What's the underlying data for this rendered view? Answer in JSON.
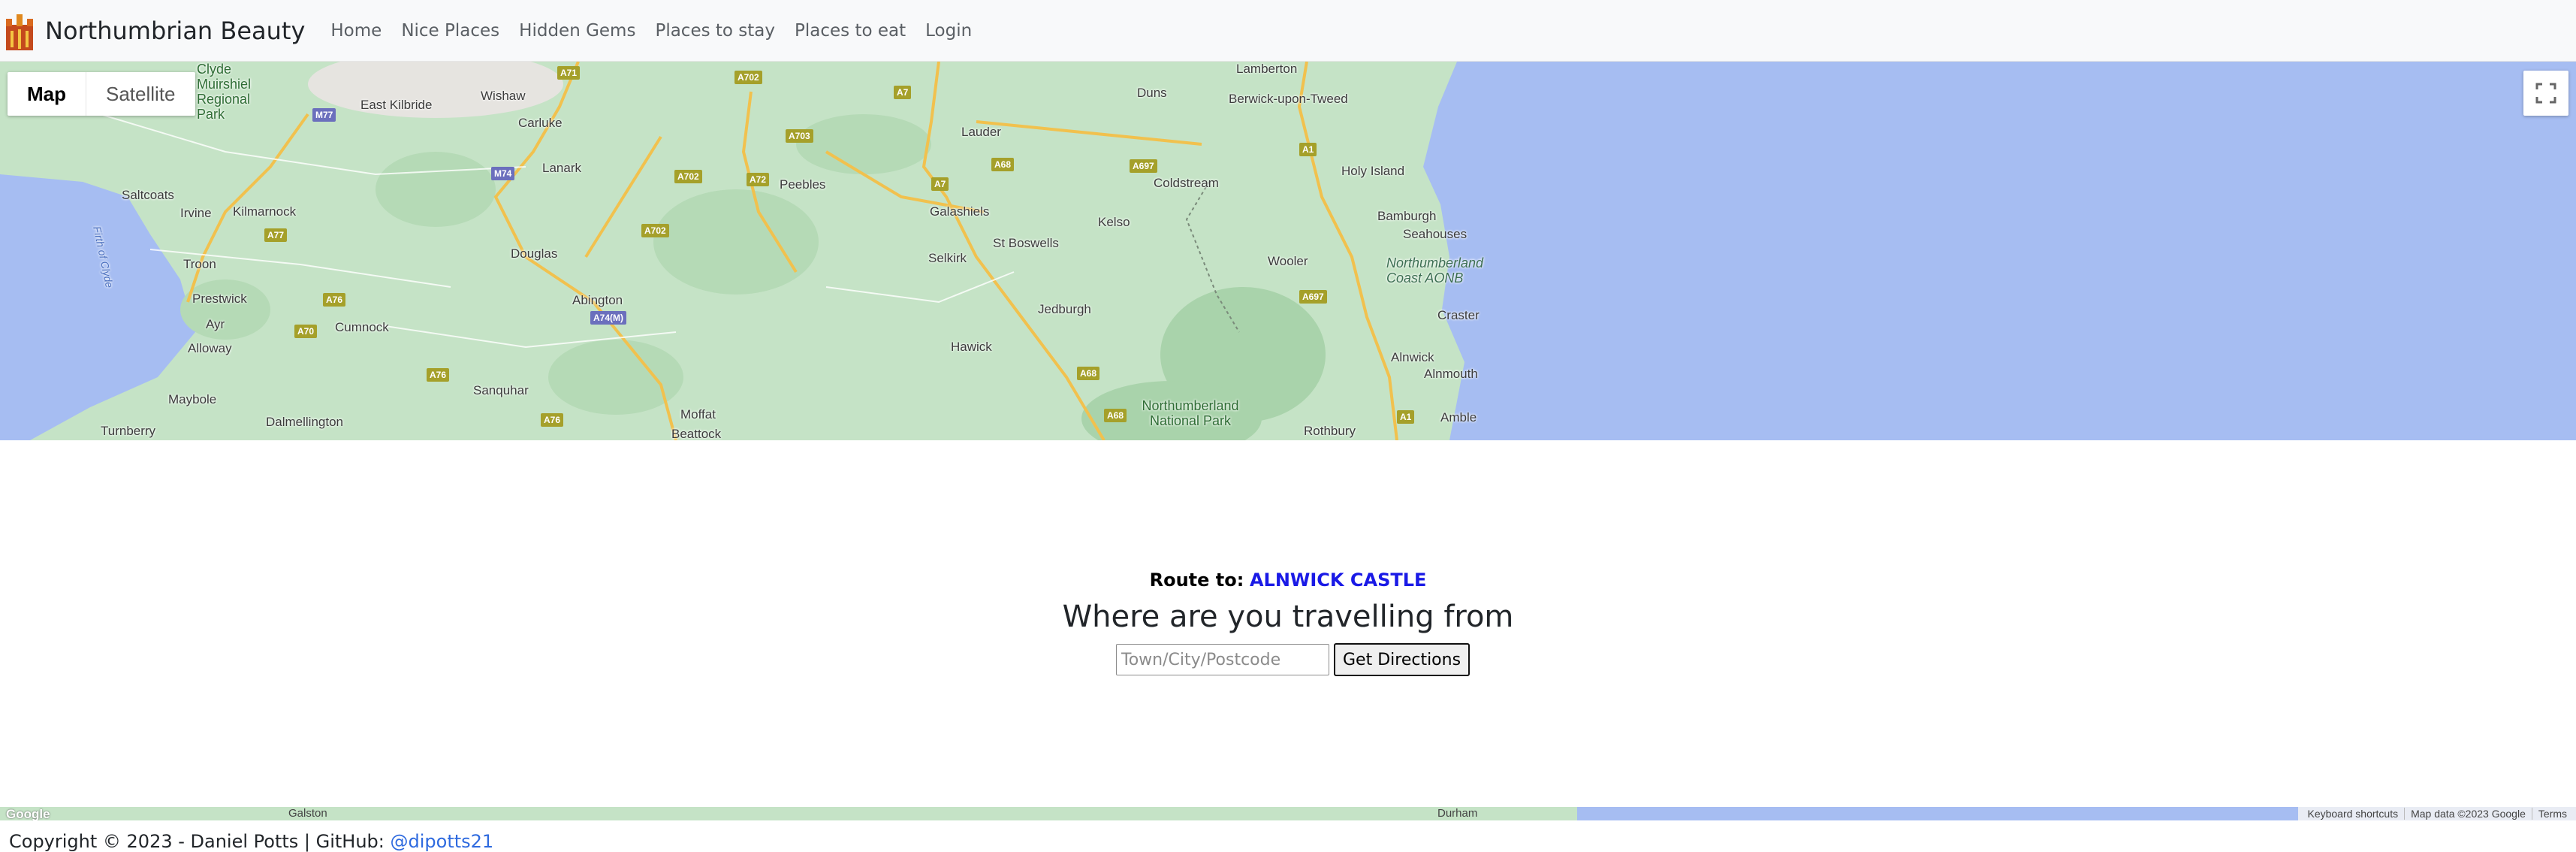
{
  "navbar": {
    "brand_name": "Northumbrian Beauty",
    "links": [
      "Home",
      "Nice Places",
      "Hidden Gems",
      "Places to stay",
      "Places to eat",
      "Login"
    ]
  },
  "map": {
    "map_types": [
      "Map",
      "Satellite"
    ],
    "active_type": "Map",
    "places": [
      "Lamberton",
      "Berwick-upon-Tweed",
      "Duns",
      "Lauder",
      "Wishaw",
      "East Kilbride",
      "Carluke",
      "Lanark",
      "Peebles",
      "Galashiels",
      "Coldstream",
      "Holy Island",
      "Saltcoats",
      "Irvine",
      "Kilmarnock",
      "Kelso",
      "Bamburgh",
      "Seahouses",
      "St Boswells",
      "Troon",
      "Douglas",
      "Selkirk",
      "Wooler",
      "Prestwick",
      "Ayr",
      "Cumnock",
      "Abington",
      "Jedburgh",
      "Craster",
      "Alloway",
      "Hawick",
      "Alnwick",
      "Alnmouth",
      "Maybole",
      "Sanquhar",
      "Moffat",
      "Turnberry",
      "Dalmellington",
      "Beattock",
      "Rothbury",
      "Amble"
    ],
    "parks": [
      "Clyde Muirshiel Regional Park",
      "Northumberland National Park"
    ],
    "aonb": "Northumberland Coast AONB",
    "water": "Firth of Clyde",
    "road_shields": [
      "A71",
      "A702",
      "A7",
      "M77",
      "M74",
      "A703",
      "A68",
      "A697",
      "A1",
      "A702",
      "A72",
      "A7",
      "A77",
      "A702",
      "A76",
      "A70",
      "A74(M)",
      "A697",
      "A76",
      "A68",
      "A68",
      "A76",
      "A1"
    ],
    "fullscreen_icon": "fullscreen-icon"
  },
  "route": {
    "label": "Route to:",
    "destination": "ALNWICK CASTLE",
    "heading": "Where are you travelling from",
    "input_placeholder": "Town/City/Postcode",
    "input_value": "",
    "button_label": "Get Directions"
  },
  "map_strip": {
    "places": [
      "Galston",
      "Durham"
    ],
    "attribution": [
      "Keyboard shortcuts",
      "Map data ©2023 Google",
      "Terms"
    ],
    "logo_text": "Google"
  },
  "footer": {
    "text": "Copyright © 2023 - Daniel Potts | GitHub: ",
    "link": "@dipotts21"
  },
  "colors": {
    "accent": "#1a1ae6",
    "link": "#2e6adf",
    "sea": "#a6bdf2",
    "land": "#c5e3c6"
  }
}
